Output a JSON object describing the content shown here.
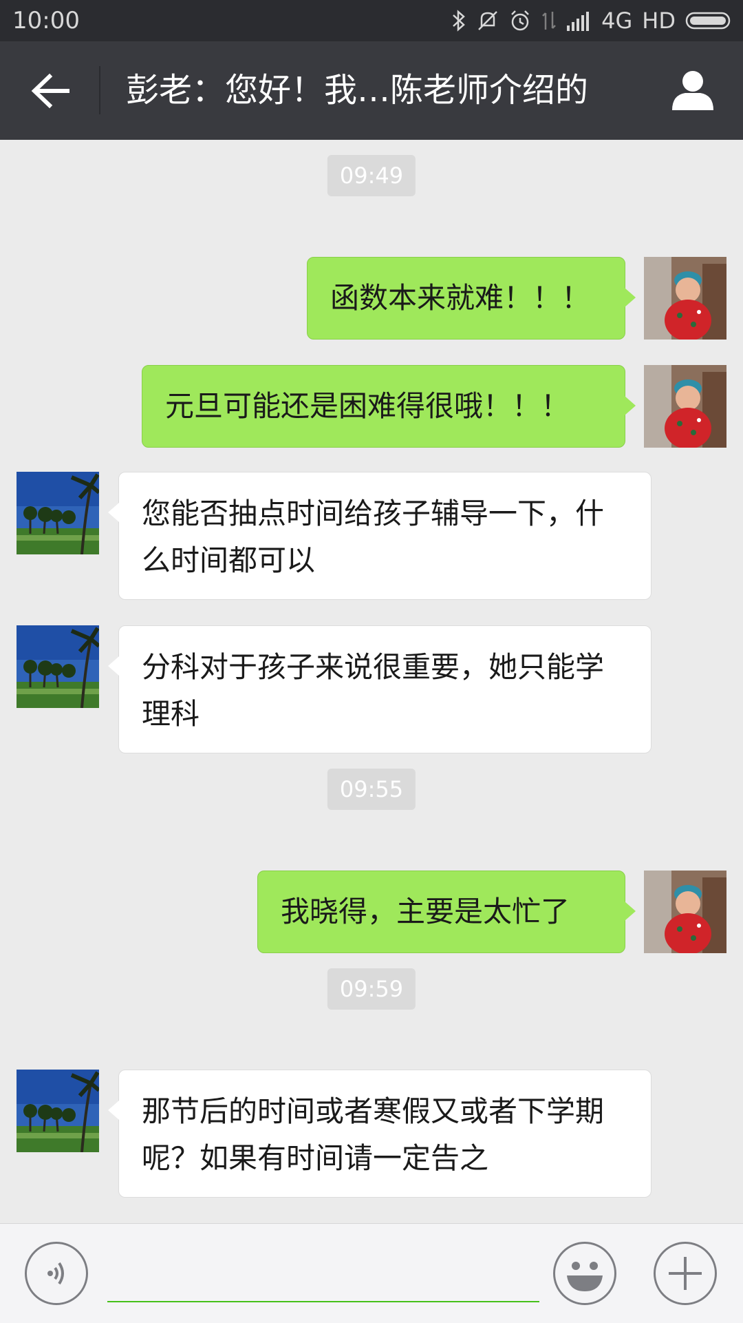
{
  "status": {
    "time": "10:00",
    "network": "4G",
    "hd": "HD"
  },
  "header": {
    "title": "彭老：您好！我…陈老师介绍的"
  },
  "messages": [
    {
      "type": "time",
      "text": "09:49"
    },
    {
      "type": "out",
      "text": "函数本来就难！！！"
    },
    {
      "type": "out",
      "text": "元旦可能还是困难得很哦！！！"
    },
    {
      "type": "in",
      "text": "您能否抽点时间给孩子辅导一下，什么时间都可以"
    },
    {
      "type": "in",
      "text": "分科对于孩子来说很重要，她只能学理科"
    },
    {
      "type": "time",
      "text": "09:55"
    },
    {
      "type": "out",
      "text": "我晓得，主要是太忙了"
    },
    {
      "type": "time",
      "text": "09:59"
    },
    {
      "type": "in",
      "text": "那节后的时间或者寒假又或者下学期呢？如果有时间请一定告之"
    }
  ],
  "input": {
    "value": "",
    "placeholder": ""
  },
  "icons": {
    "back": "arrow-left-icon",
    "profile": "person-icon",
    "voice": "voice-icon",
    "emoji": "emoji-icon",
    "plus": "plus-icon"
  },
  "colors": {
    "outgoing_bubble": "#9fe85b",
    "incoming_bubble": "#ffffff",
    "header_bg": "#393a3f",
    "accent": "#45c01a"
  }
}
